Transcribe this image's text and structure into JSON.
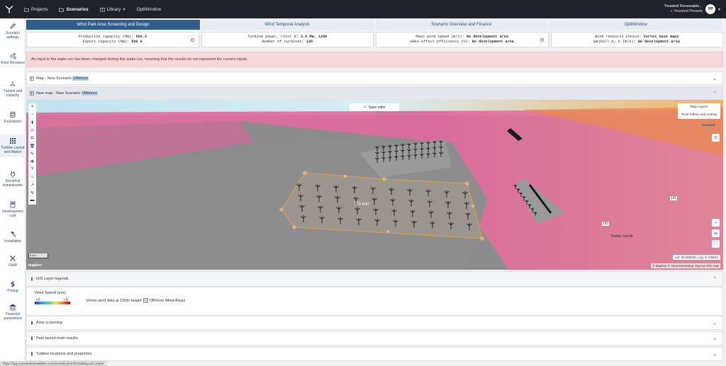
{
  "nav": {
    "logo_icon": "youwind-logo-icon",
    "items": [
      {
        "label": "Projects",
        "icon": "folder-icon"
      },
      {
        "label": "Scenarios",
        "icon": "folder-icon"
      },
      {
        "label": "Library",
        "icon": "book-icon"
      },
      {
        "label": "OptiWindow",
        "icon": ""
      }
    ],
    "user": {
      "company": "Youwind Renewable...",
      "preset": "Youwind Presets",
      "initials": "YP"
    }
  },
  "sidebar": {
    "items": [
      {
        "label": "Scenario settings",
        "icon": "pencil-icon"
      },
      {
        "label": "Wind Resource",
        "icon": "wind-icon"
      },
      {
        "label": "Turbine and capacity",
        "icon": "turbine-icon"
      },
      {
        "label": "Foundation",
        "icon": "database-icon"
      },
      {
        "label": "Turbine Layout and Wakes",
        "icon": "grid-icon"
      },
      {
        "label": "Electrical transmission",
        "icon": "plug-icon"
      },
      {
        "label": "Development cost",
        "icon": "document-icon"
      },
      {
        "label": "Installation",
        "icon": "hammer-icon"
      },
      {
        "label": "O&M",
        "icon": "tools-icon"
      },
      {
        "label": "Pricing",
        "icon": "dollar-icon"
      },
      {
        "label": "Financial parameters",
        "icon": "bank-icon"
      }
    ]
  },
  "tabs": [
    {
      "label": "Wind Park Area Screening and Design"
    },
    {
      "label": "Wind Temporal Analysis"
    },
    {
      "label": "Scenario Overview and Finance"
    },
    {
      "label": "OptiWindow"
    }
  ],
  "stats": {
    "production": {
      "line1_label": "Production capacity (MW):",
      "line1_value": "500.4",
      "line2_label": "Export capacity (MW):",
      "line2_value": "500.0"
    },
    "turbine": {
      "line1_label": "Turbine power, rotor ø:",
      "line1_value": "3.6 MW, 120m",
      "line2_label": "Number of turbines:",
      "line2_value": "139"
    },
    "wind": {
      "line1_label": "Mean wind speed (m/s):",
      "line1_value": "No development area",
      "line2_label": "Wake effect efficiency (%):",
      "line2_value": "No development area"
    },
    "resource": {
      "line1_label": "Wind resource choice:",
      "line1_value": "Vortex base maps",
      "line2_label": "Weibull A, k (m/s):",
      "line2_value": "No development area"
    }
  },
  "alert": "An input to the wake run has been changed during this wake run, meaning that the results do not represent the current inputs.",
  "sections": {
    "map_old": {
      "label": "Map - New Scenario",
      "highlight": "Offshore"
    },
    "map_new": {
      "label": "New map - New Scenario",
      "highlight": "Offshore"
    },
    "gis": {
      "label": "GIS Layer legends"
    },
    "screening": {
      "label": "Area screening"
    },
    "park": {
      "label": "Park layout main results"
    },
    "turbines": {
      "label": "Turbine locations and properties"
    }
  },
  "map": {
    "save_label": "Save edits",
    "layers_label": "Map Layers",
    "pixel_label": "Pixel Filters and sorting",
    "youwind_label": "Youwind",
    "area_label": "779 km²",
    "scale_label": "5 km",
    "mapbox_label": "mapbox",
    "place_label": "Rødby Sande",
    "latlng": "Lat: 55.080008, Lng: 8.729842",
    "attribution": "© Mapbox © OpenStreetMap Improve this map",
    "road_labels": [
      "E45",
      "181",
      "181",
      "175",
      "11"
    ]
  },
  "legend": {
    "title": "Wind Speed (m/s)",
    "min": "<2",
    "max": ">11",
    "vortex_label": "Vortex wind data at 150m height",
    "offshore_label": "Offshore Wind Areas",
    "colors": [
      "#3b2ec9",
      "#2ba3f0",
      "#3ee08a",
      "#f7e64a",
      "#f1702a",
      "#b4120f"
    ]
  },
  "status_url": "https://app.youwindrenewables.com/scenarios/15757/editlayoutContent"
}
